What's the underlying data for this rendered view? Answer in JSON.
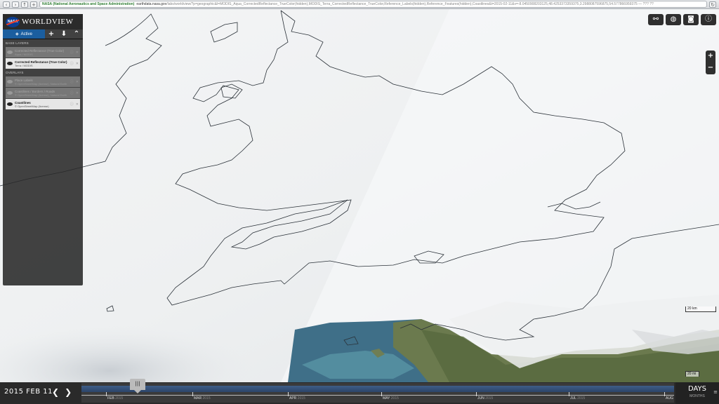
{
  "browser": {
    "site_badge": "NASA (National Aeronautics and Space Administration)",
    "url_domain": "earthdata.nasa.gov",
    "url_path": "/labs/worldview/?p=geographic&l=MODIS_Aqua_CorrectedReflectance_TrueColor(hidden),MODIS_Terra_CorrectedReflectance_TrueColor,Reference_Labels(hidden),Reference_Features(hidden),Coastlines&t=2015-02-11&v=-8.0450908203125,48.4253373359375,3.2988087596875,54.577866959375 — ??? ??"
  },
  "brand": {
    "logo_text": "NASA",
    "title": "WORLDVIEW"
  },
  "panel": {
    "active_tab": "Active",
    "add_icon": "plus-icon",
    "download_icon": "download-icon",
    "collapse_icon": "chevron-up-icon",
    "base_layers_label": "BASE LAYERS",
    "overlays_label": "OVERLAYS",
    "base_layers": [
      {
        "name": "Corrected Reflectance (True Color)",
        "sub": "Aqua / MODIS",
        "visible": false
      },
      {
        "name": "Corrected Reflectance (True Color)",
        "sub": "Terra / MODIS",
        "visible": true
      }
    ],
    "overlays": [
      {
        "name": "Place Labels",
        "sub": "© OpenStreetMap (license), Natural Earth",
        "visible": false
      },
      {
        "name": "Coastlines / Borders / Roads",
        "sub": "© OpenStreetMap (license), Natural Earth",
        "visible": false
      },
      {
        "name": "Coastlines",
        "sub": "© OpenStreetMap (license)",
        "visible": true
      }
    ]
  },
  "tools": [
    "link-icon",
    "globe-icon",
    "camera-icon",
    "info-icon"
  ],
  "zoom": {
    "in": "+",
    "out": "−"
  },
  "scale": {
    "km": "20 km",
    "mi": "20 mi"
  },
  "timeline": {
    "date": "2015 FEB 11",
    "prev": "❮",
    "next": "❯",
    "months": [
      {
        "label": "FEB",
        "year": "2015"
      },
      {
        "label": "MAR",
        "year": "2015"
      },
      {
        "label": "APR",
        "year": "2015"
      },
      {
        "label": "MAY",
        "year": "2015"
      },
      {
        "label": "JUN",
        "year": "2015"
      },
      {
        "label": "JUL",
        "year": "2015"
      },
      {
        "label": "AUG",
        "year": ""
      }
    ],
    "interval": "DAYS",
    "interval_sub": "MONTHS"
  }
}
